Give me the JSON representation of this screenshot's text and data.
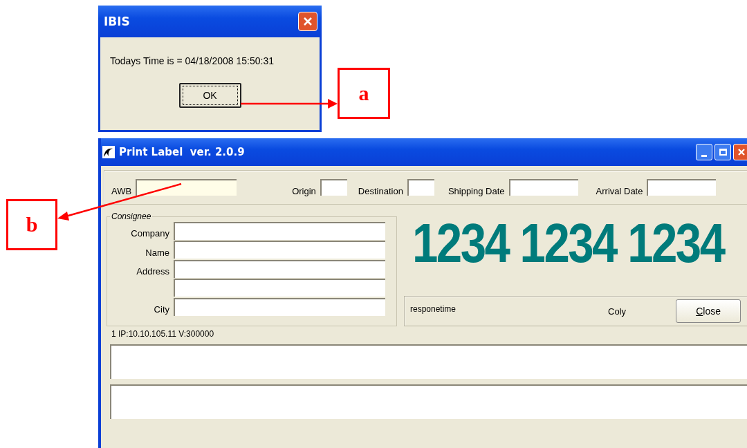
{
  "dialog": {
    "title": "IBIS",
    "message": "Todays Time is = 04/18/2008 15:50:31",
    "ok_button": "OK"
  },
  "main_window": {
    "title": "Print Label  ver. 2.0.9",
    "header_fields": [
      {
        "label": "AWB",
        "kind": "wide",
        "highlighted": true
      },
      {
        "label": "Origin",
        "kind": "short",
        "highlighted": false
      },
      {
        "label": "Destination",
        "kind": "short",
        "highlighted": false
      },
      {
        "label": "Shipping Date",
        "kind": "date",
        "highlighted": false
      },
      {
        "label": "Arrival Date",
        "kind": "date",
        "highlighted": false
      }
    ],
    "consignee": {
      "legend": "Consignee",
      "fields": [
        {
          "kind": "labeled",
          "label": "Company"
        },
        {
          "kind": "labeled",
          "label": "Name"
        },
        {
          "kind": "labeled",
          "label": "Address"
        },
        {
          "kind": "continuation"
        },
        {
          "kind": "labeled",
          "label": "City"
        }
      ]
    },
    "big_number": "1234 1234 1234",
    "response": {
      "label": "responetime",
      "value": "Coly",
      "close_button": {
        "label": "Close",
        "mnemonic_first_letter": true
      }
    },
    "status": "1 IP:10.10.105.11  V:300000"
  },
  "annotations": [
    {
      "label": "a"
    },
    {
      "label": "b"
    }
  ]
}
